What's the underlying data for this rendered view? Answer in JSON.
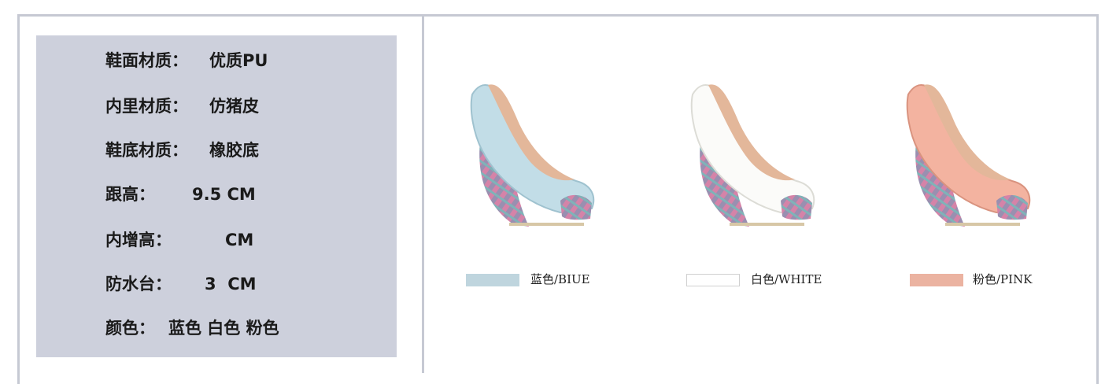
{
  "specs": [
    {
      "label": "鞋面材质：",
      "value": "优质PU"
    },
    {
      "label": "内里材质：",
      "value": "仿猪皮"
    },
    {
      "label": "鞋底材质：",
      "value": "橡胶底"
    },
    {
      "label": "跟高：",
      "value": "9.5 CM"
    },
    {
      "label": "内增高：",
      "value": "CM"
    },
    {
      "label": "防水台：",
      "value": "3  CM"
    },
    {
      "label": "颜色：",
      "value": "蓝色 白色 粉色"
    }
  ],
  "colors": [
    {
      "name": "蓝色/BIUE",
      "swatch": "#bfd5de",
      "upper": "#c2dde7",
      "upper_dark": "#9fc2cf"
    },
    {
      "name": "白色/WHITE",
      "swatch": "#ffffff",
      "upper": "#fbfbf9",
      "upper_dark": "#dcdcd6"
    },
    {
      "name": "粉色/PINK",
      "swatch": "#ebb3a1",
      "upper": "#f3b3a0",
      "upper_dark": "#d9937f"
    }
  ]
}
